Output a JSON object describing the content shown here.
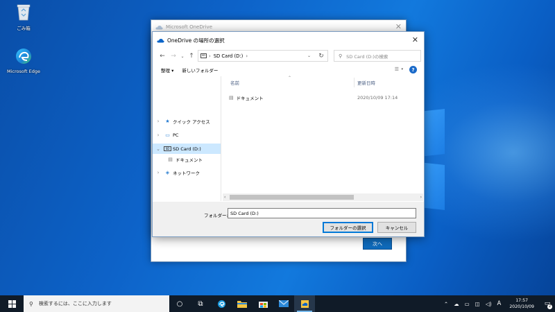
{
  "desktop": {
    "icons": [
      {
        "label": "ごみ箱",
        "icon": "recycle-bin-icon"
      },
      {
        "label": "Microsoft Edge",
        "icon": "edge-icon"
      }
    ]
  },
  "onedrive_window": {
    "title": "Microsoft OneDrive",
    "next_button": "次へ"
  },
  "dialog": {
    "title": "OneDrive の場所の選択",
    "address": {
      "segments": [
        "SD Card (D:)"
      ]
    },
    "search_placeholder": "SD Card (D:)の検索",
    "commands": {
      "organize": "整理 ▾",
      "new_folder": "新しいフォルダー"
    },
    "nav": [
      {
        "label": "クイック アクセス",
        "icon": "star-icon",
        "expanded": false
      },
      {
        "label": "PC",
        "icon": "pc-icon",
        "expanded": false
      },
      {
        "label": "SD Card (D:)",
        "icon": "sd-card-icon",
        "expanded": true,
        "selected": true
      },
      {
        "label": "ドキュメント",
        "icon": "document-icon",
        "child": true
      },
      {
        "label": "ネットワーク",
        "icon": "network-icon",
        "expanded": false
      }
    ],
    "columns": {
      "name": "名前",
      "modified": "更新日時"
    },
    "files": [
      {
        "name": "ドキュメント",
        "modified": "2020/10/09 17:14"
      }
    ],
    "folder_label": "フォルダー:",
    "folder_value": "SD Card (D:)",
    "select_button": "フォルダーの選択",
    "cancel_button": "キャンセル"
  },
  "taskbar": {
    "search_placeholder": "検索するには、ここに入力します",
    "clock_time": "17:57",
    "clock_date": "2020/10/09",
    "ime_indicator": "A",
    "notification_count": "2"
  },
  "colors": {
    "accent": "#0078d7",
    "taskbar": "#101b28",
    "selection": "#cce8ff"
  }
}
